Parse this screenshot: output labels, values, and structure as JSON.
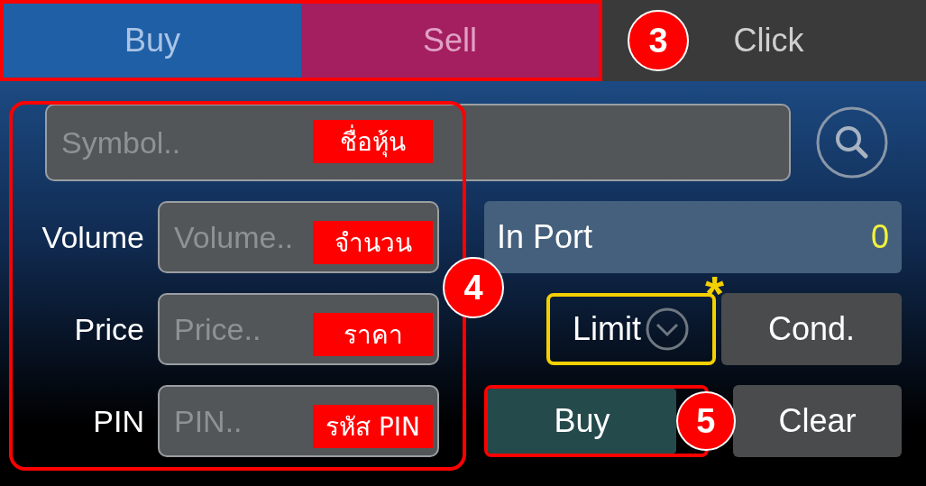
{
  "tabs": [
    {
      "label": "Buy",
      "kind": "buy"
    },
    {
      "label": "Sell",
      "kind": "sell"
    },
    {
      "label": "Click",
      "kind": "plain"
    }
  ],
  "symbol": {
    "placeholder": "Symbol.."
  },
  "fields": [
    {
      "label": "Volume",
      "placeholder": "Volume.."
    },
    {
      "label": "Price",
      "placeholder": "Price.."
    },
    {
      "label": "PIN",
      "placeholder": "PIN.."
    }
  ],
  "in_port": {
    "label": "In Port",
    "value": "0"
  },
  "order_type": {
    "value": "Limit"
  },
  "buttons": [
    {
      "label": "Cond.",
      "kind": "plain"
    },
    {
      "label": "Buy",
      "kind": "buy"
    },
    {
      "label": "Clear",
      "kind": "plain"
    }
  ],
  "annotations": {
    "badges": [
      "3",
      "4",
      "5"
    ],
    "asterisk": "*",
    "labels": [
      "ชื่อหุ้น",
      "จำนวน",
      "ราคา",
      "รหัส PIN"
    ]
  }
}
